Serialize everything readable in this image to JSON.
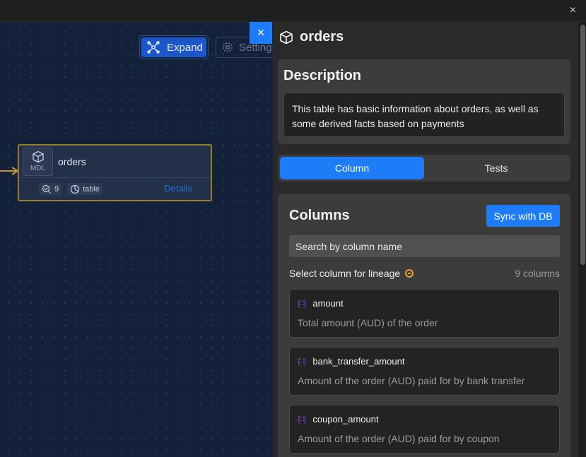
{
  "window": {
    "close_symbol": "×"
  },
  "canvas": {
    "expand_label": "Expand",
    "settings_label": "Settings",
    "node": {
      "badge": "MDL",
      "name": "orders",
      "tests_count": "9",
      "type_label": "table",
      "details_label": "Details"
    }
  },
  "panel": {
    "close_symbol": "×",
    "title": "orders",
    "description_heading": "Description",
    "description_text": "This table has basic information about orders, as well as some derived facts based on payments",
    "tabs": [
      {
        "label": "Column",
        "active": true
      },
      {
        "label": "Tests",
        "active": false
      }
    ],
    "columns_heading": "Columns",
    "sync_label": "Sync with DB",
    "search_placeholder": "Search by column name",
    "lineage_label": "Select column for lineage",
    "columns_count": "9 columns",
    "columns": [
      {
        "type_glyph": "{∷}",
        "name": "amount",
        "description": "Total amount (AUD) of the order"
      },
      {
        "type_glyph": "{∷}",
        "name": "bank_transfer_amount",
        "description": "Amount of the order (AUD) paid for by bank transfer"
      },
      {
        "type_glyph": "{∷}",
        "name": "coupon_amount",
        "description": "Amount of the order (AUD) paid for by coupon"
      }
    ]
  },
  "colors": {
    "accent": "#1e7cf8",
    "node_border": "#9a7a2c",
    "canvas_bg": "#14213a",
    "panel_bg": "#2a2a2a"
  }
}
